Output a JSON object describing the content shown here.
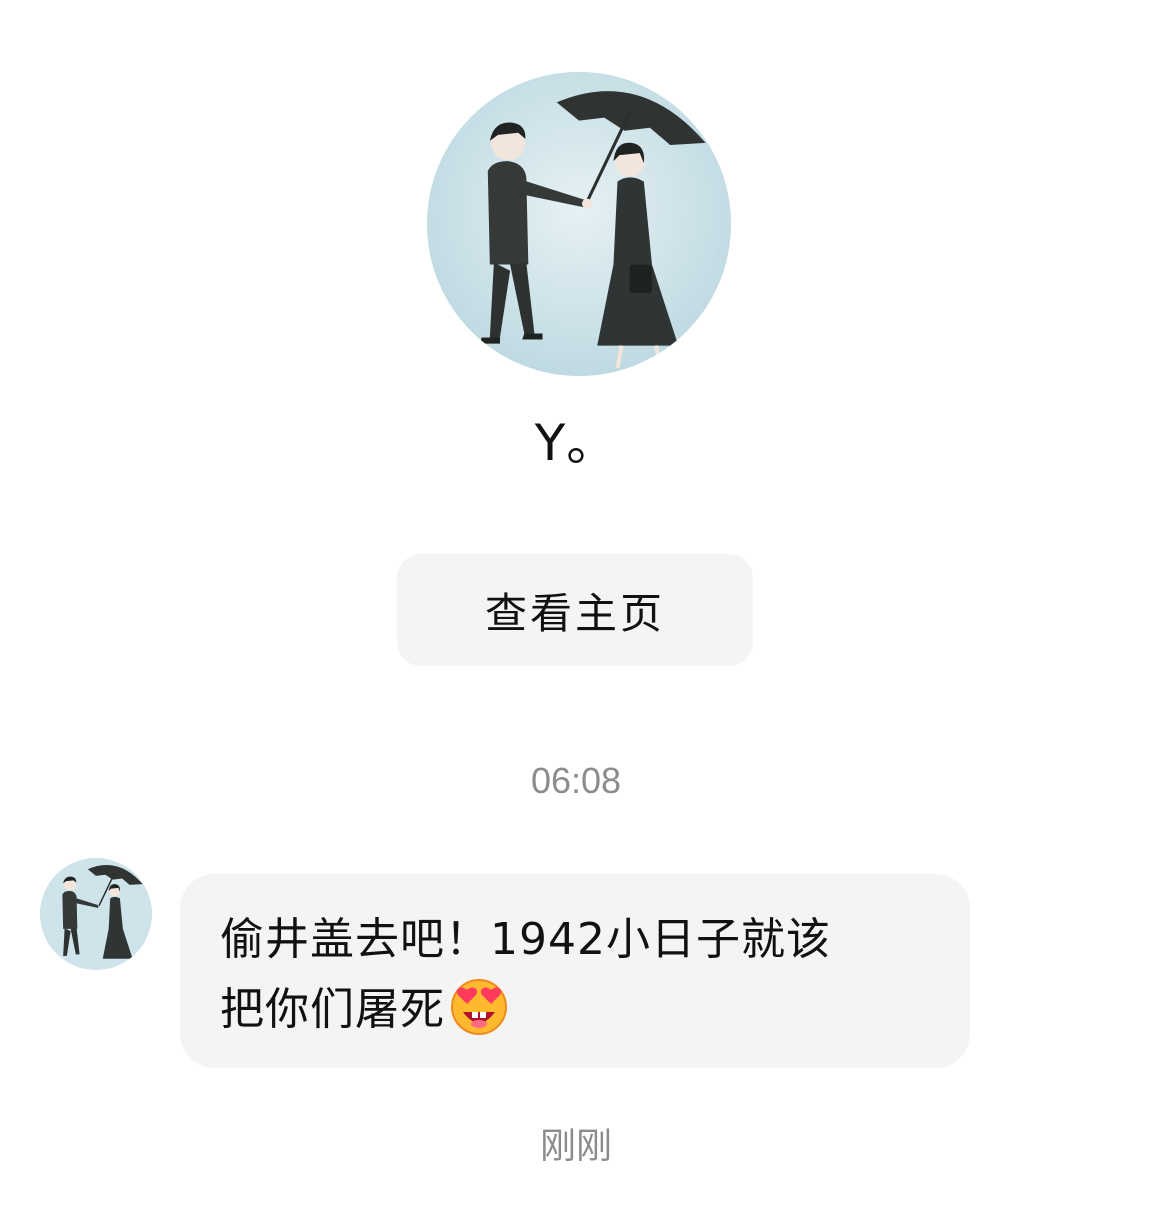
{
  "profile": {
    "avatar_icon": "couple-with-umbrella-avatar",
    "username": "Y。",
    "view_home_label": "查看主页"
  },
  "chat": {
    "timestamp": "06:08",
    "message": {
      "sender_avatar_icon": "couple-with-umbrella-avatar",
      "line1": "偷井盖去吧！1942小日子就该",
      "line2": "把你们屠死",
      "emoji_icon": "star-struck-emoji-icon"
    },
    "status": "刚刚"
  },
  "colors": {
    "background": "#ffffff",
    "bubble": "#f4f4f4",
    "muted_text": "#8c8c8c",
    "avatar_sky": "#cfe4ea"
  }
}
